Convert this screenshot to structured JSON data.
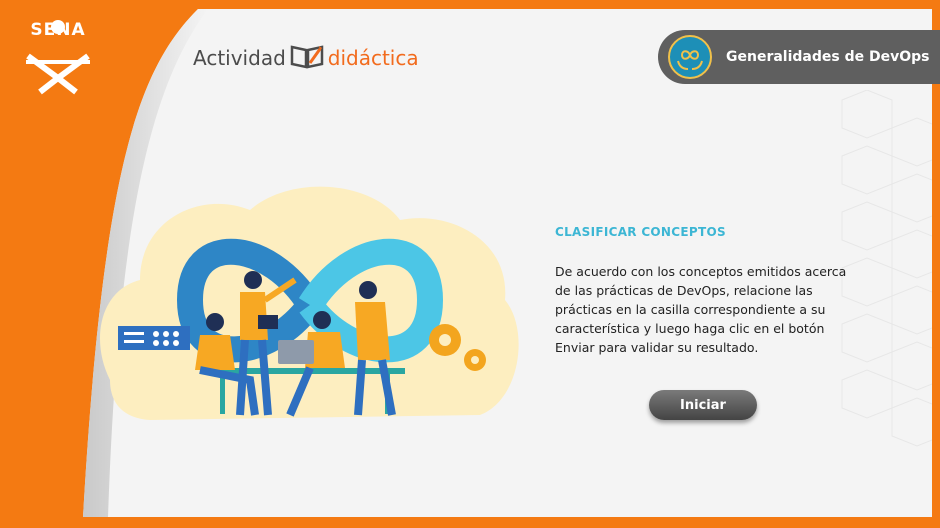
{
  "brand": {
    "logo_text": "SENA"
  },
  "activity": {
    "word1": "Actividad",
    "word2": "didáctica"
  },
  "topic": {
    "label": "Generalidades de DevOps",
    "icon": "devops-hands-icon"
  },
  "content": {
    "title": "CLASIFICAR CONCEPTOS",
    "body": "De acuerdo con los conceptos emitidos acerca de las prácticas de DevOps, relacione las prácticas en la casilla correspondiente a su característica y luego haga clic en el botón Enviar para validar su resultado."
  },
  "actions": {
    "start_label": "Iniciar"
  },
  "colors": {
    "frame": "#f47a12",
    "title": "#3cb6d4",
    "accent": "#f26b1d",
    "topic_bg": "#5f5f5f"
  }
}
